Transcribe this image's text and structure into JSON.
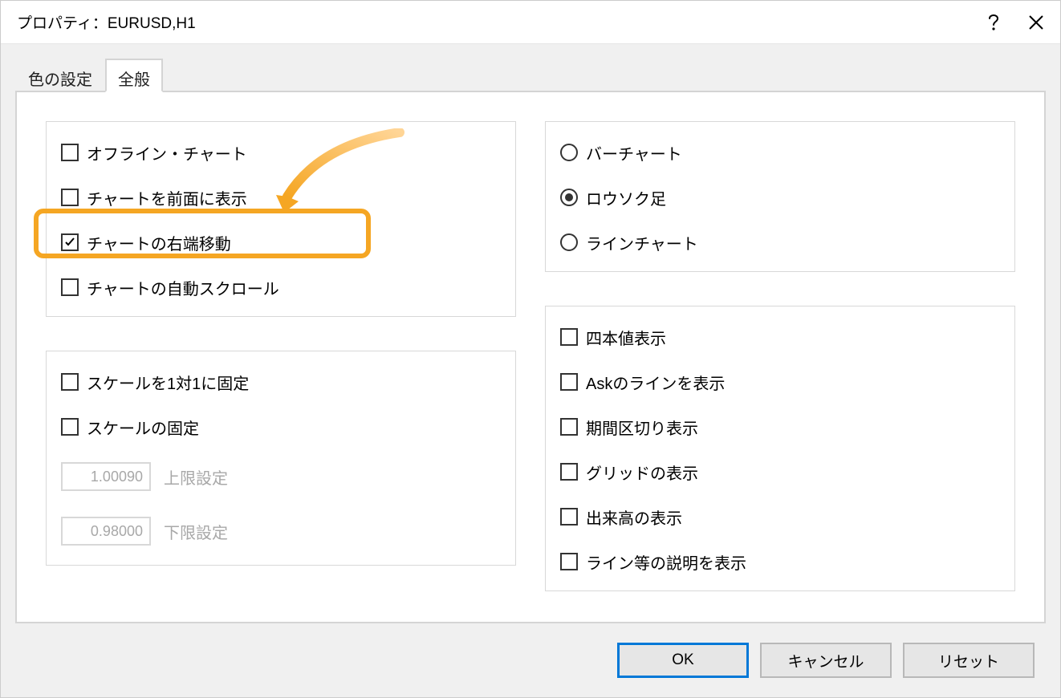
{
  "window": {
    "title": "プロパティ：EURUSD,H1"
  },
  "tabs": {
    "t0": "色の設定",
    "t1": "全般"
  },
  "left_group1": {
    "offline": "オフライン・チャート",
    "front": "チャートを前面に表示",
    "shift": "チャートの右端移動",
    "autoscroll": "チャートの自動スクロール"
  },
  "left_group2": {
    "scale11": "スケールを1対1に固定",
    "scaleFix": "スケールの固定",
    "upper_val": "1.00090",
    "upper_lbl": "上限設定",
    "lower_val": "0.98000",
    "lower_lbl": "下限設定"
  },
  "right_group1": {
    "bar": "バーチャート",
    "candle": "ロウソク足",
    "line": "ラインチャート"
  },
  "right_group2": {
    "ohlc": "四本値表示",
    "ask": "Askのラインを表示",
    "period": "期間区切り表示",
    "grid": "グリッドの表示",
    "volume": "出来高の表示",
    "descr": "ライン等の説明を表示"
  },
  "buttons": {
    "ok": "OK",
    "cancel": "キャンセル",
    "reset": "リセット"
  }
}
